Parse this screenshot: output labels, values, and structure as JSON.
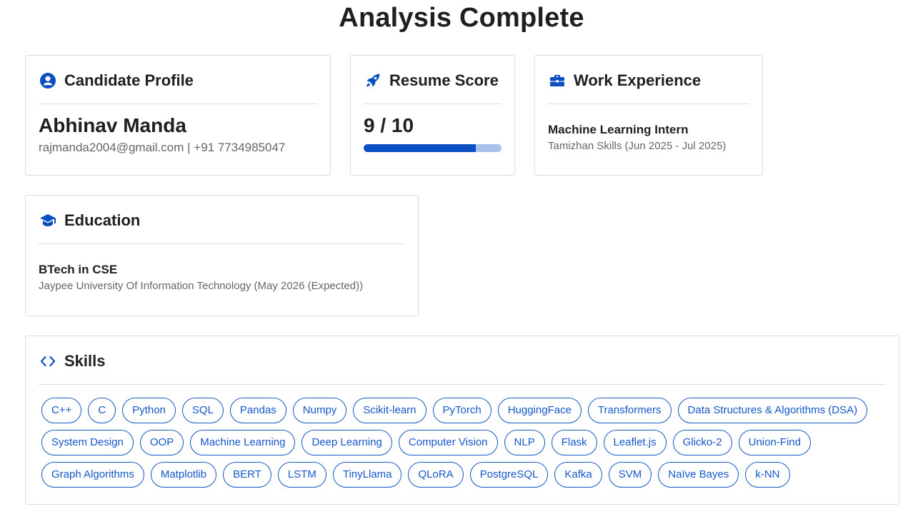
{
  "page_title": "Analysis Complete",
  "profile": {
    "heading": "Candidate Profile",
    "name": "Abhinav Manda",
    "contact": "rajmanda2004@gmail.com | +91 7734985047"
  },
  "score": {
    "heading": "Resume Score",
    "value_text": "9 / 10",
    "value": 9,
    "max": 10
  },
  "work": {
    "heading": "Work Experience",
    "role": "Machine Learning Intern",
    "details": "Tamizhan Skills (Jun 2025 - Jul 2025)"
  },
  "education": {
    "heading": "Education",
    "degree": "BTech in CSE",
    "details": "Jaypee University Of Information Technology (May 2026 (Expected))"
  },
  "skills": {
    "heading": "Skills",
    "items": [
      "C++",
      "C",
      "Python",
      "SQL",
      "Pandas",
      "Numpy",
      "Scikit-learn",
      "PyTorch",
      "HuggingFace",
      "Transformers",
      "Data Structures & Algorithms (DSA)",
      "System Design",
      "OOP",
      "Machine Learning",
      "Deep Learning",
      "Computer Vision",
      "NLP",
      "Flask",
      "Leaflet.js",
      "Glicko-2",
      "Union-Find",
      "Graph Algorithms",
      "Matplotlib",
      "BERT",
      "LSTM",
      "TinyLlama",
      "QLoRA",
      "PostgreSQL",
      "Kafka",
      "SVM",
      "Naïve Bayes",
      "k-NN"
    ]
  },
  "colors": {
    "accent": "#0b4fc3",
    "bar_track": "#a7c1ec",
    "border": "#d9dde3"
  },
  "icons": {
    "profile": "user-circle-icon",
    "score": "rocket-icon",
    "work": "briefcase-icon",
    "education": "graduation-cap-icon",
    "skills": "code-icon"
  }
}
